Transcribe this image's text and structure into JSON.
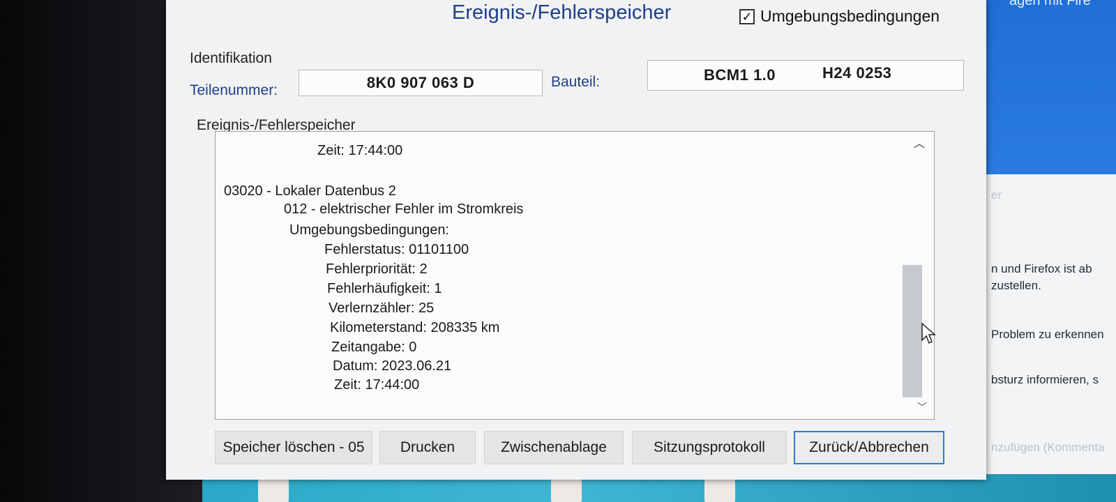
{
  "dialog": {
    "title": "Ereignis-/Fehlerspeicher",
    "env_checkbox": {
      "label": "Umgebungsbedingungen",
      "checked": true
    }
  },
  "identification": {
    "section_label": "Identifikation",
    "part_number_label": "Teilenummer:",
    "part_number": "8K0 907 063 D",
    "component_label": "Bauteil:",
    "component_name": "BCM1 1.0",
    "component_code": "H24 0253"
  },
  "fault_memory": {
    "group_label": "Ereignis-/Fehlerspeicher",
    "lines": [
      "Zeit: 17:44:00",
      "03020 - Lokaler Datenbus 2",
      "012 - elektrischer Fehler im Stromkreis",
      "Umgebungsbedingungen:",
      "Fehlerstatus: 01101100",
      "Fehlerpriorität: 2",
      "Fehlerhäufigkeit: 1",
      "Verlernzähler: 25",
      "Kilometerstand: 208335 km",
      "Zeitangabe: 0",
      "Datum: 2023.06.21",
      "Zeit: 17:44:00"
    ]
  },
  "buttons": {
    "clear": "Speicher löschen - 05",
    "print": "Drucken",
    "clipboard": "Zwischenablage",
    "session_log": "Sitzungsprotokoll",
    "back_cancel": "Zurück/Abbrechen"
  },
  "background_window": {
    "title_fragment": "agen mit Fire",
    "lines": [
      "er",
      "n und Firefox ist ab",
      "zustellen.",
      "Problem zu erkennen",
      "bsturz informieren, s",
      "nzufügen (Kommenta"
    ]
  },
  "colors": {
    "title_blue": "#1f3f8c",
    "dialog_bg": "#f1f2f3",
    "primary_border": "#2f7bd6",
    "bg_titlebar": "#1f6fd6"
  }
}
